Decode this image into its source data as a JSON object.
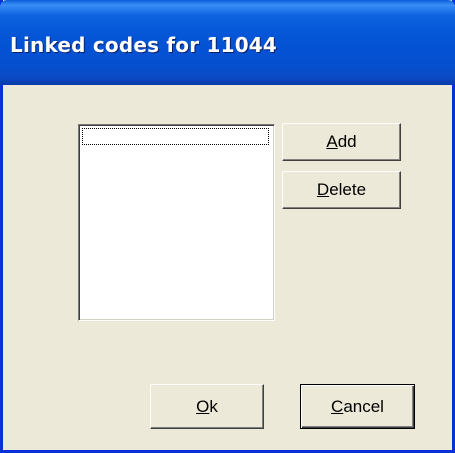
{
  "window": {
    "title": "Linked codes for 11044"
  },
  "list": {
    "items": []
  },
  "buttons": {
    "add": {
      "mnemonic": "A",
      "rest": "dd"
    },
    "delete": {
      "mnemonic": "D",
      "rest": "elete"
    },
    "ok": {
      "mnemonic": "O",
      "rest": "k"
    },
    "cancel": {
      "mnemonic": "C",
      "rest": "ancel"
    }
  }
}
